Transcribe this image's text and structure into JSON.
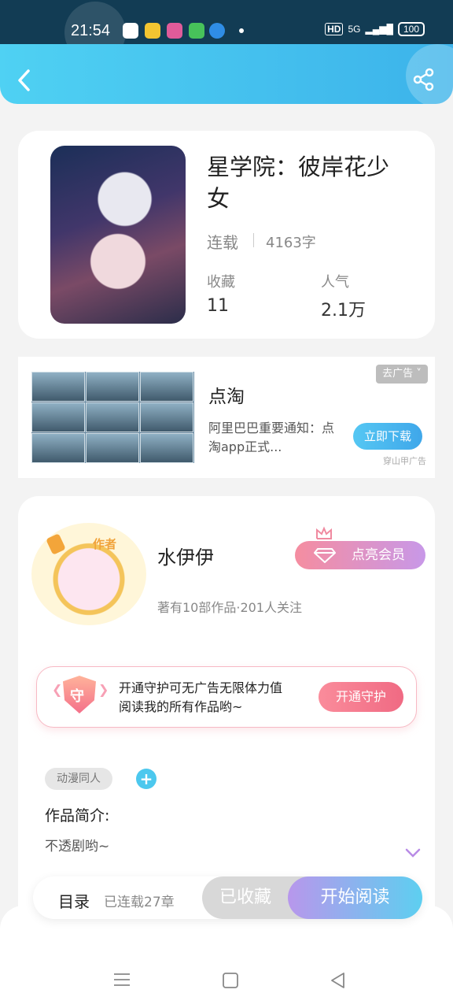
{
  "status_bar": {
    "time": "21:54",
    "network": "HD",
    "signal": "5G",
    "battery": "100"
  },
  "book": {
    "title": "星学院：彼岸花少女",
    "status": "连载",
    "word_count": "4163字",
    "favorites_label": "收藏",
    "favorites_value": "11",
    "popularity_label": "人气",
    "popularity_value": "2.1万"
  },
  "ad": {
    "remove_label": "去广告",
    "title": "点淘",
    "description": "阿里巴巴重要通知：点淘app正式...",
    "button_label": "立即下载",
    "source": "穿山甲广告"
  },
  "author": {
    "badge": "作者",
    "name": "水伊伊",
    "vip_button": "点亮会员",
    "stats": "著有10部作品·201人关注"
  },
  "guard": {
    "icon_text": "守",
    "text_line1": "开通守护可无广告无限体力值",
    "text_line2": "阅读我的所有作品哟~",
    "button_label": "开通守护"
  },
  "tags": [
    "动漫同人"
  ],
  "intro": {
    "label": "作品简介:",
    "text": "不透剧哟~"
  },
  "bottom": {
    "catalog_label": "目录",
    "chapters": "已连载27章",
    "collected_label": "已收藏",
    "start_label": "开始阅读"
  },
  "colors": {
    "accent": "#3fb4ea",
    "pink": "#f06a83",
    "purple": "#b897ec"
  }
}
